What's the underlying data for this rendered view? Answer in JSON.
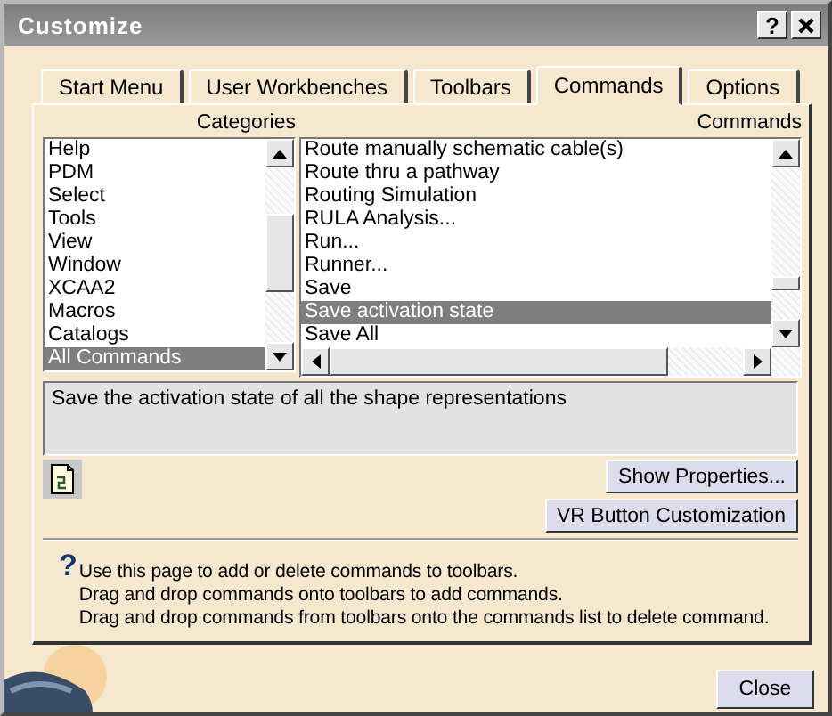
{
  "window": {
    "title": "Customize",
    "help_button": "?"
  },
  "tabs": [
    {
      "label": "Start Menu",
      "selected": false
    },
    {
      "label": "User Workbenches",
      "selected": false
    },
    {
      "label": "Toolbars",
      "selected": false
    },
    {
      "label": "Commands",
      "selected": true
    },
    {
      "label": "Options",
      "selected": false
    }
  ],
  "categories": {
    "label": "Categories",
    "items": [
      {
        "label": "Help",
        "selected": false
      },
      {
        "label": "PDM",
        "selected": false
      },
      {
        "label": "Select",
        "selected": false
      },
      {
        "label": "Tools",
        "selected": false
      },
      {
        "label": "View",
        "selected": false
      },
      {
        "label": "Window",
        "selected": false
      },
      {
        "label": "XCAA2",
        "selected": false
      },
      {
        "label": "Macros",
        "selected": false
      },
      {
        "label": "Catalogs",
        "selected": false
      },
      {
        "label": "All Commands",
        "selected": true
      }
    ]
  },
  "commands": {
    "label": "Commands",
    "items": [
      {
        "label": "Route manually schematic cable(s)",
        "selected": false
      },
      {
        "label": "Route thru a pathway",
        "selected": false
      },
      {
        "label": "Routing Simulation",
        "selected": false
      },
      {
        "label": "RULA Analysis...",
        "selected": false
      },
      {
        "label": "Run...",
        "selected": false
      },
      {
        "label": "Runner...",
        "selected": false
      },
      {
        "label": "Save",
        "selected": false
      },
      {
        "label": "Save activation state",
        "selected": true
      },
      {
        "label": "Save All",
        "selected": false
      }
    ]
  },
  "description": "Save the activation state of all the shape representations",
  "buttons": [
    "Show Properties...",
    "VR Button Customization"
  ],
  "help_mark": "?",
  "help_lines": [
    "Use this page to add or delete commands to toolbars.",
    "Drag and drop commands onto toolbars to add commands.",
    "Drag and drop commands from toolbars onto the commands list to delete command."
  ],
  "close_button": "Close"
}
